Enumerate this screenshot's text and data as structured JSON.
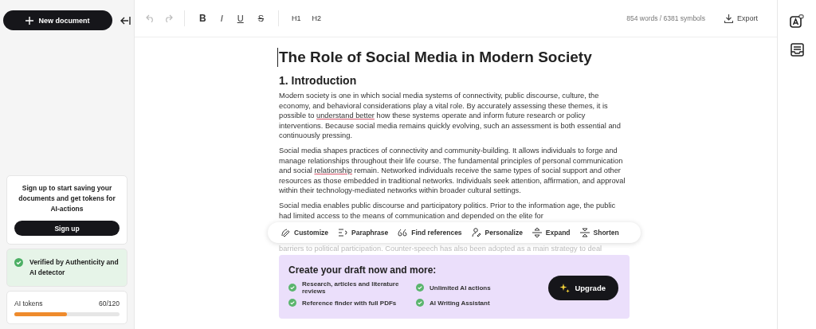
{
  "sidebar": {
    "new_document_button": "New document",
    "signup_card": {
      "text": "Sign up to start saving your documents and get tokens for AI-actions",
      "button": "Sign up"
    },
    "verified_card": {
      "text": "Verified by Authenticity and AI detector",
      "verified": true
    },
    "tokens_card": {
      "label": "AI tokens",
      "count": "60/120",
      "level": 0.5
    }
  },
  "toolbar": {
    "undo_disabled": true,
    "redo_disabled": true,
    "format_buttons": [
      {
        "label": "B",
        "kind": "bold"
      },
      {
        "label": "I",
        "kind": "italic"
      },
      {
        "label": "U",
        "kind": "underline"
      },
      {
        "label": "S",
        "kind": "strike"
      }
    ],
    "heading_buttons": [
      "H1",
      "H2"
    ],
    "stats": "854 words / 6381 symbols",
    "export": "Export"
  },
  "document": {
    "title": "The Role of Social Media in Modern Society",
    "heading": "1. Introduction",
    "paragraphs": [
      [
        {
          "text": "Modern society is one in which social media systems of connectivity, public discourse, culture, the economy, and behavioral considerations play a vital role. By accurately assessing these themes, it is possible to ",
          "flagged": false
        },
        {
          "text": "understand better",
          "flagged": true
        },
        {
          "text": " how these systems operate and inform future research or policy interventions. Because social media remains quickly evolving, such an assessment is both essential and continuously pressing.",
          "flagged": false
        }
      ],
      [
        {
          "text": "Social media shapes practices of connectivity and community-building. It allows individuals to forge and manage relationships throughout their life course. The fundamental principles of personal communication and social ",
          "flagged": false
        },
        {
          "text": "relationship",
          "flagged": true
        },
        {
          "text": " remain. Networked individuals receive the same types of social support and other resources as those embedded in traditional networks. Individuals seek attention, affirmation, and approval within their technology-mediated networks within broader cultural settings.",
          "flagged": false
        }
      ],
      [
        {
          "text": "Social media enables public discourse and participatory politics. Prior to the information age, the public had limited access to the means of communication and depended on the elite for",
          "flagged": false
        }
      ]
    ],
    "faded_line": "barriers to political participation. Counter-speech has also been adopted as a main strategy to deal"
  },
  "ai_actions": [
    {
      "label": "Customize",
      "kind": "customize"
    },
    {
      "label": "Paraphrase",
      "kind": "paraphrase"
    },
    {
      "label": "Find references",
      "kind": "references"
    },
    {
      "label": "Personalize",
      "kind": "personalize"
    },
    {
      "label": "Expand",
      "kind": "expand"
    },
    {
      "label": "Shorten",
      "kind": "shorten"
    }
  ],
  "promo": {
    "title": "Create your draft now and more:",
    "features": [
      "Research, articles and literature reviews",
      "Unlimited AI actions",
      "Reference finder with full PDFs",
      "AI Writing Assistant"
    ],
    "button": "Upgrade"
  }
}
